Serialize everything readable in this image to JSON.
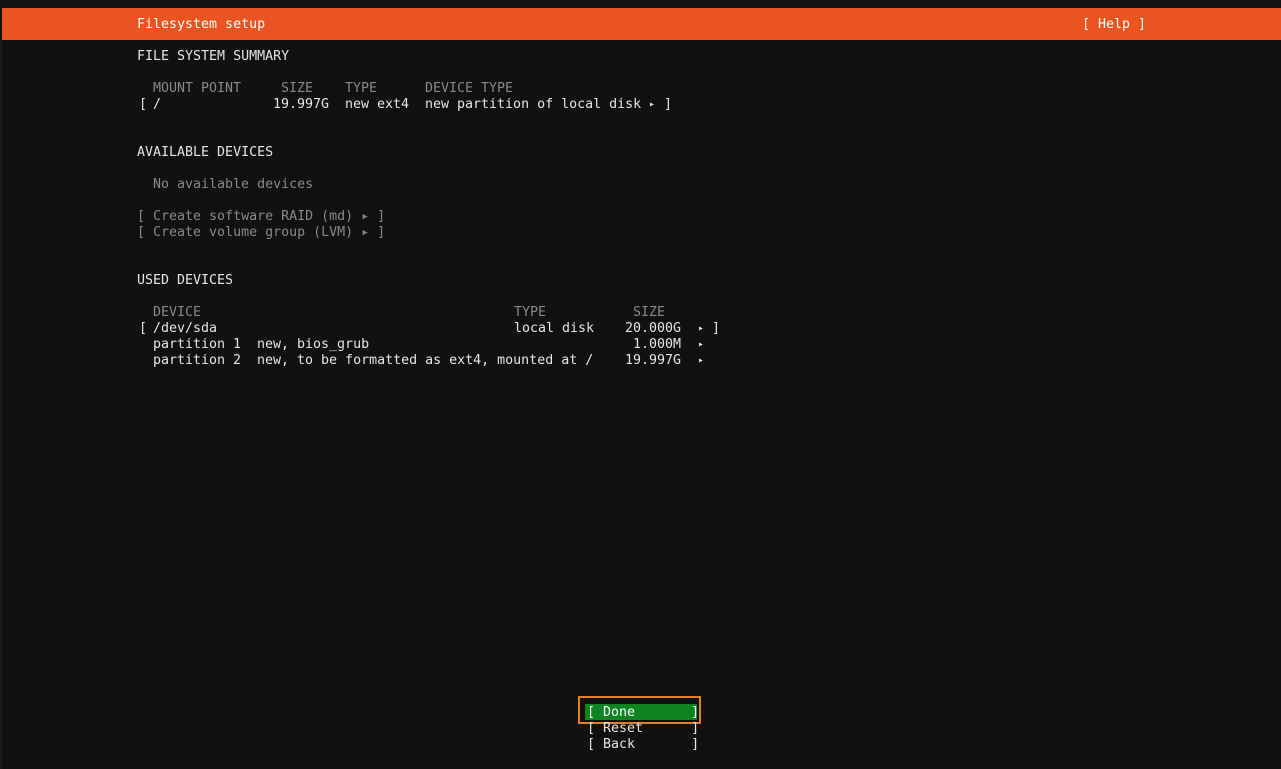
{
  "header": {
    "title": "Filesystem setup",
    "help_label": "[ Help ]",
    "accent": "#e95420"
  },
  "summary": {
    "heading": "FILE SYSTEM SUMMARY",
    "columns": [
      "MOUNT POINT",
      "SIZE",
      "TYPE",
      "DEVICE TYPE"
    ],
    "row": {
      "open": "[",
      "mount": "/",
      "size": "19.997G",
      "type": "new ext4",
      "device_type": "new partition of local disk",
      "arrow": "▸",
      "close": "]"
    }
  },
  "available": {
    "heading": "AVAILABLE DEVICES",
    "empty_text": "No available devices",
    "actions": [
      {
        "label": "[ Create software RAID (md) ▸ ]"
      },
      {
        "label": "[ Create volume group (LVM) ▸ ]"
      }
    ]
  },
  "used": {
    "heading": "USED DEVICES",
    "columns": [
      "DEVICE",
      "TYPE",
      "SIZE"
    ],
    "disk": {
      "open": "[",
      "device": "/dev/sda",
      "type": "local disk",
      "size": "20.000G",
      "arrow": "▸",
      "close": "]"
    },
    "partitions": [
      {
        "name": "partition 1",
        "desc": "new, bios_grub",
        "size": "1.000M",
        "arrow": "▸"
      },
      {
        "name": "partition 2",
        "desc": "new, to be formatted as ext4, mounted at /",
        "size": "19.997G",
        "arrow": "▸"
      }
    ]
  },
  "buttons": {
    "done": "[ Done       ]",
    "reset": "[ Reset      ]",
    "back": "[ Back       ]",
    "selected_color": "#0e8420",
    "focus_color": "#e37f29"
  }
}
